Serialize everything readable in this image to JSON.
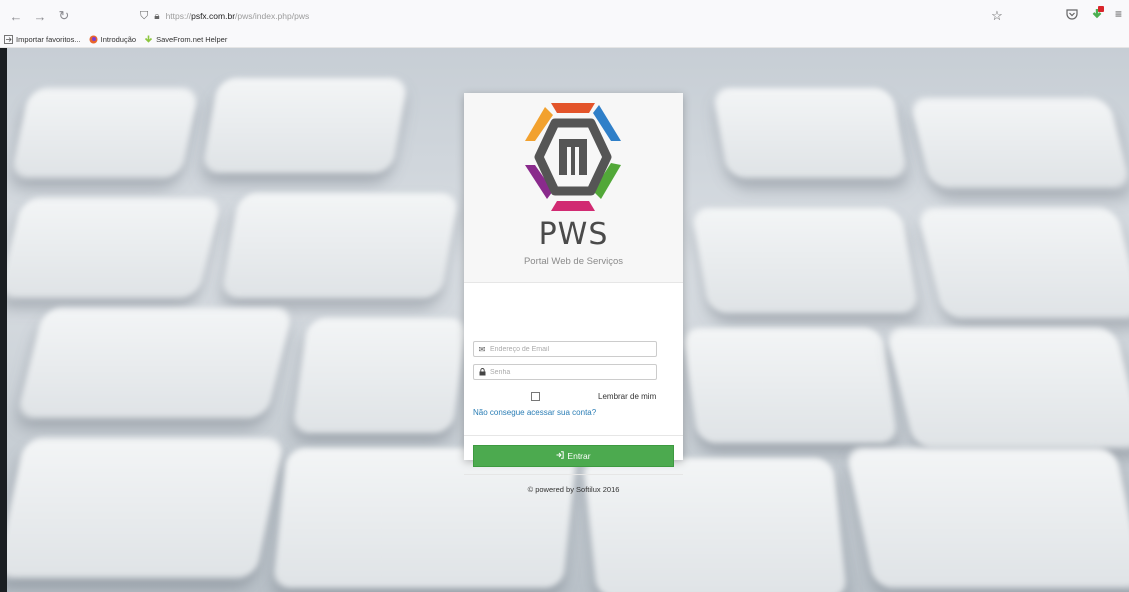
{
  "browser": {
    "url_plain": "https://",
    "url_domain": "psfx.com.br",
    "url_path": "/pws/index.php/pws",
    "bookmarks": [
      {
        "label": "Importar favoritos...",
        "icon": "import-icon"
      },
      {
        "label": "Introdução",
        "icon": "firefox-icon"
      },
      {
        "label": "SaveFrom.net Helper",
        "icon": "savefrom-icon"
      }
    ]
  },
  "login": {
    "brand": "PWS",
    "subtitle": "Portal Web de Serviços",
    "email_placeholder": "Endereço de Email",
    "password_placeholder": "Senha",
    "remember_label": "Lembrar de mim",
    "forgot_link": "Não consegue acessar sua conta?",
    "enter_label": "Entrar",
    "footer": "© powered by Softilux 2016"
  },
  "colors": {
    "enter_button": "#4caa4f",
    "link": "#2a7db5"
  }
}
